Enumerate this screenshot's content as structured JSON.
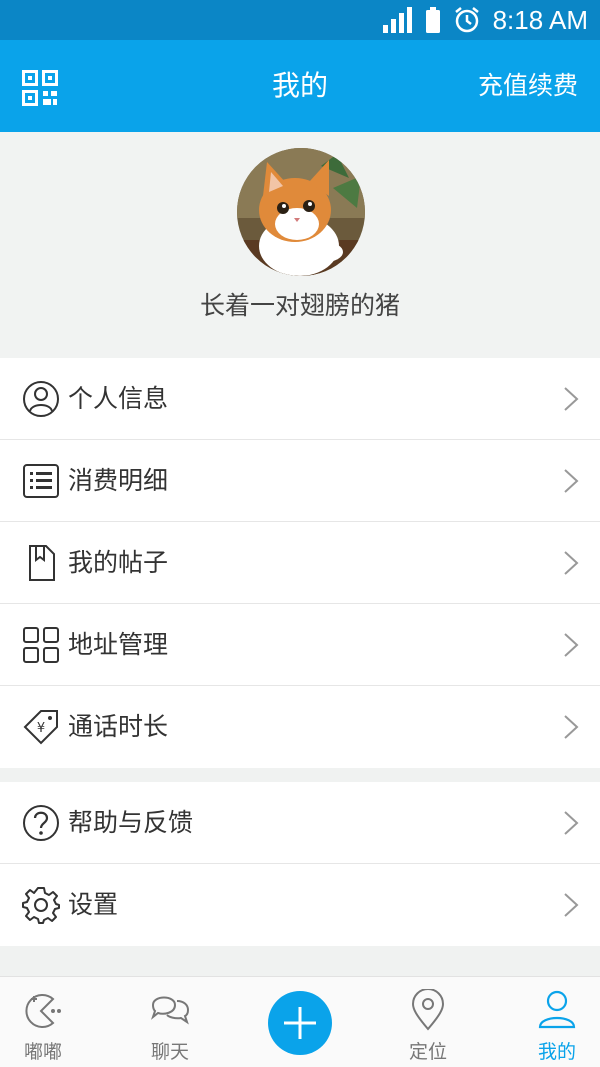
{
  "status_bar": {
    "time": "8:18 AM",
    "signal_icon": "signal-icon",
    "battery_icon": "battery-icon",
    "alarm_icon": "alarm-icon"
  },
  "app_bar": {
    "title": "我的",
    "right_action": "充值续费",
    "left_icon": "qr-code-icon"
  },
  "profile": {
    "username": "长着一对翅膀的猪",
    "avatar": "kitten-photo"
  },
  "menu_group_1": [
    {
      "label": "个人信息",
      "icon": "user-icon"
    },
    {
      "label": "消费明细",
      "icon": "list-icon"
    },
    {
      "label": "我的帖子",
      "icon": "document-icon"
    },
    {
      "label": "地址管理",
      "icon": "grid-icon"
    },
    {
      "label": "通话时长",
      "icon": "yen-tag-icon"
    }
  ],
  "menu_group_2": [
    {
      "label": "帮助与反馈",
      "icon": "question-icon"
    },
    {
      "label": "设置",
      "icon": "gear-icon"
    }
  ],
  "tab_bar": {
    "items": [
      {
        "label": "嘟嘟",
        "icon": "pacman-icon"
      },
      {
        "label": "聊天",
        "icon": "chat-bubbles-icon"
      },
      {
        "label": "定位",
        "icon": "location-pin-icon"
      },
      {
        "label": "我的",
        "icon": "person-icon",
        "active": true
      }
    ],
    "center_icon": "plus-icon"
  },
  "colors": {
    "primary": "#0aa3ea",
    "status_bar": "#0b86c6",
    "background": "#f0f2f1"
  }
}
